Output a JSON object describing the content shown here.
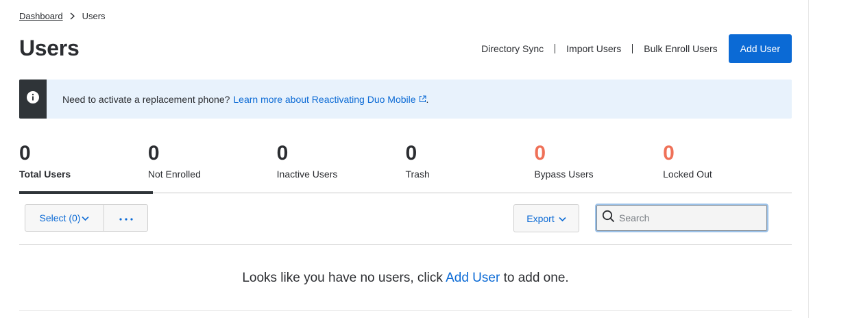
{
  "breadcrumb": {
    "items": [
      "Dashboard",
      "Users"
    ]
  },
  "page": {
    "title": "Users"
  },
  "header_actions": {
    "directory_sync": "Directory Sync",
    "import_users": "Import Users",
    "bulk_enroll": "Bulk Enroll Users",
    "add_user": "Add User"
  },
  "banner": {
    "text": "Need to activate a replacement phone?",
    "link": "Learn more about Reactivating Duo Mobile",
    "suffix": ".",
    "icon": "info-icon"
  },
  "stats": [
    {
      "value": "0",
      "label": "Total Users",
      "active": true
    },
    {
      "value": "0",
      "label": "Not Enrolled"
    },
    {
      "value": "0",
      "label": "Inactive Users"
    },
    {
      "value": "0",
      "label": "Trash"
    },
    {
      "value": "0",
      "label": "Bypass Users",
      "alert": true
    },
    {
      "value": "0",
      "label": "Locked Out",
      "alert": true
    }
  ],
  "toolbar": {
    "select_label": "Select (0)",
    "more_label": "more-options",
    "export_label": "Export",
    "search_placeholder": "Search"
  },
  "empty_state": {
    "prefix": "Looks like you have no users, click ",
    "link": "Add User",
    "suffix": " to add one."
  },
  "colors": {
    "accent": "#0b6ad5",
    "alert": "#ef7158",
    "banner_bg": "#e8f2fc",
    "dark": "#2f3438"
  }
}
